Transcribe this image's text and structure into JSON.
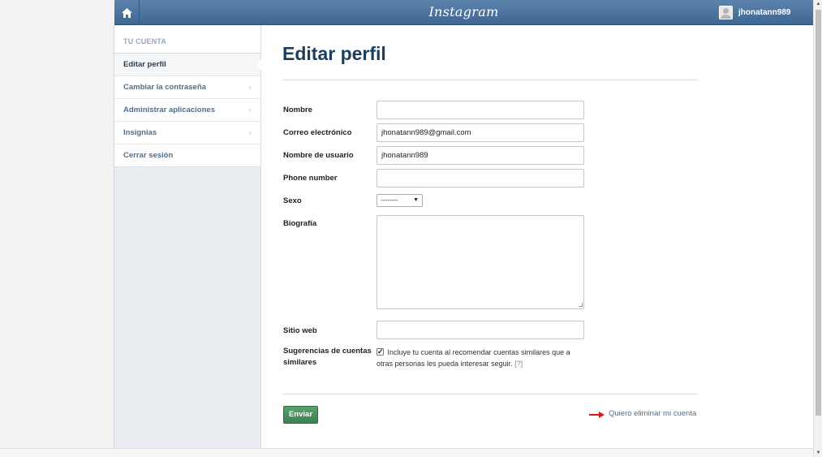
{
  "header": {
    "logo": "Instagram",
    "username": "jhonatann989"
  },
  "sidebar": {
    "heading": "TU CUENTA",
    "items": [
      {
        "label": "Editar perfil"
      },
      {
        "label": "Cambiar la contraseña"
      },
      {
        "label": "Administrar aplicaciones"
      },
      {
        "label": "Insignias"
      },
      {
        "label": "Cerrar sesión"
      }
    ]
  },
  "form": {
    "title": "Editar perfil",
    "name_label": "Nombre",
    "name_value": "",
    "email_label": "Correo electrónico",
    "email_value": "jhonatann989@gmail.com",
    "username_label": "Nombre de usuario",
    "username_value": "jhonatann989",
    "phone_label": "Phone number",
    "phone_value": "",
    "gender_label": "Sexo",
    "gender_value": "--------",
    "bio_label": "Biografía",
    "bio_value": "",
    "website_label": "Sitio web",
    "website_value": "",
    "suggestions_label": "Sugerencias de cuentas similares",
    "suggestions_text": "Incluye tu cuenta al recomendar cuentas similares que a otras personas les pueda interesar seguir.",
    "suggestions_help": "[?]",
    "submit_label": "Enviar",
    "delete_link": "Quiero eliminar mi cuenta"
  },
  "colors": {
    "header": "#4a72a0",
    "title": "#1c3d5e",
    "link": "#4d6f93",
    "submit": "#4a9160",
    "arrow": "#d9181c"
  }
}
